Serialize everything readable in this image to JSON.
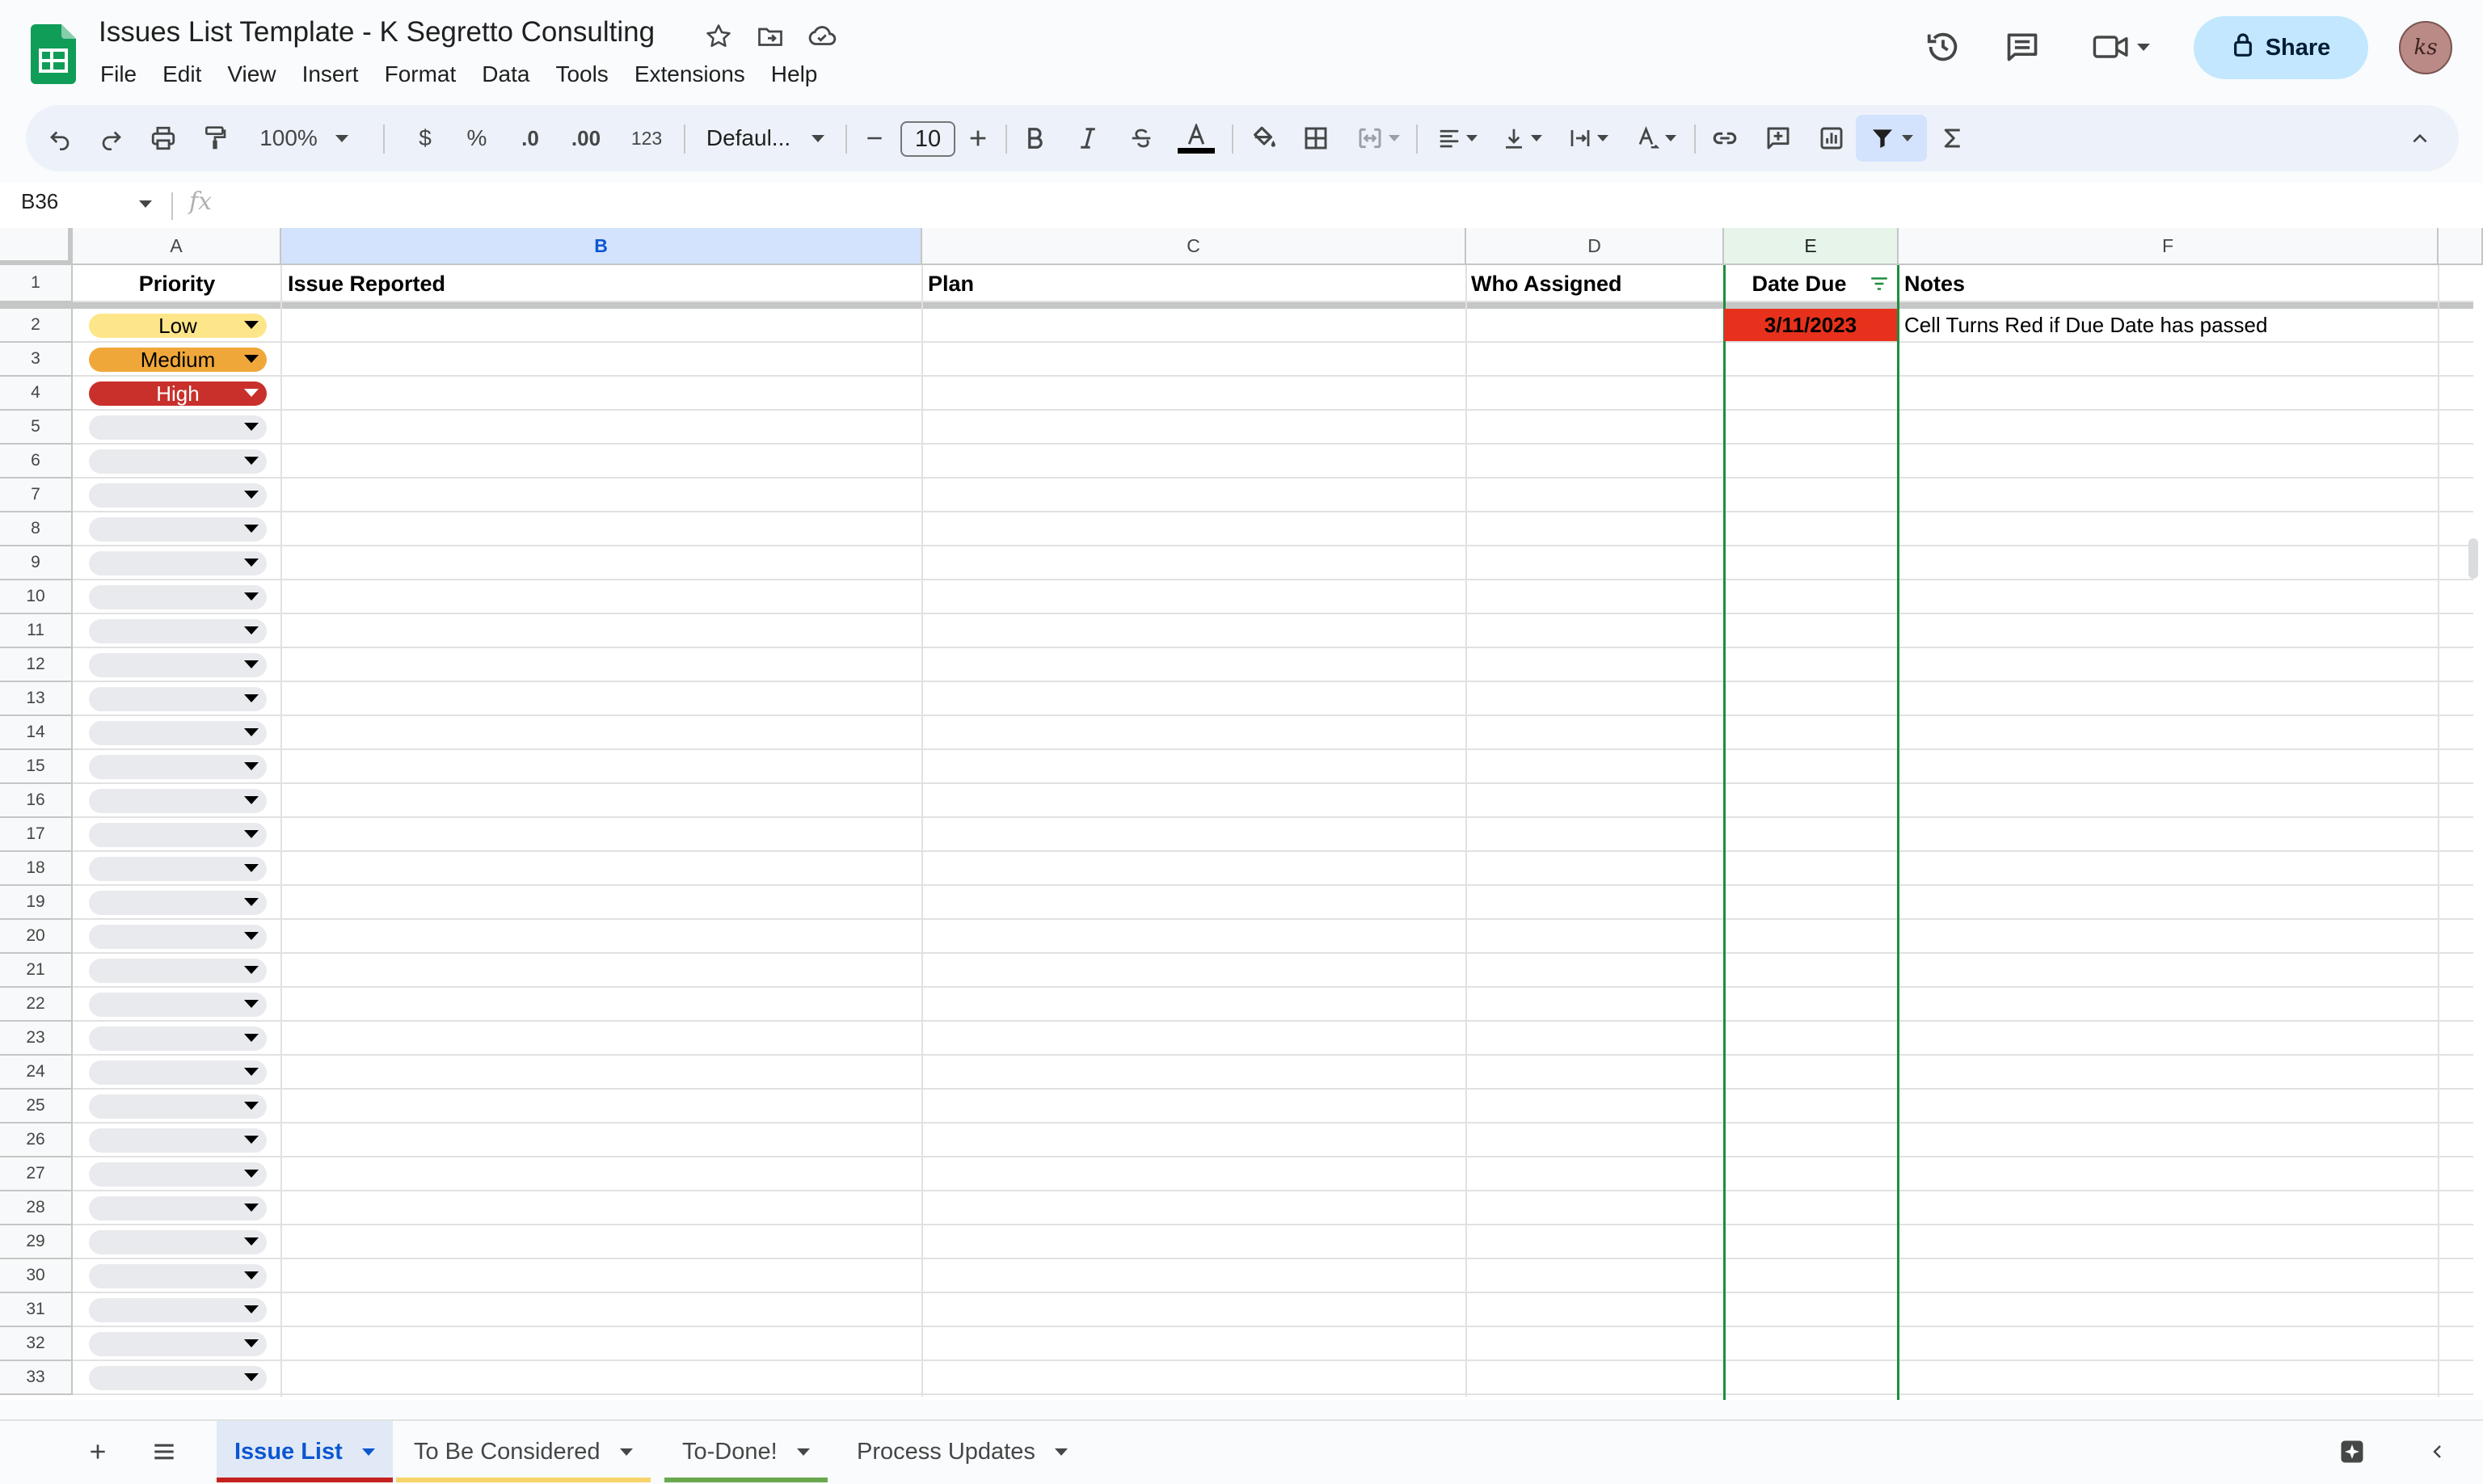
{
  "window": {
    "doc_title": "Issues List Template - K Segretto Consulting",
    "share_label": "Share",
    "avatar_initials": "ks"
  },
  "menu": [
    "File",
    "Edit",
    "View",
    "Insert",
    "Format",
    "Data",
    "Tools",
    "Extensions",
    "Help"
  ],
  "toolbar": {
    "zoom": "100%",
    "currency": "$",
    "percent": "%",
    "decrease_decimal": ".0",
    "increase_decimal": ".00",
    "number_format": "123",
    "font": "Defaul...",
    "font_size": "10"
  },
  "formula_bar": {
    "cell_ref": "B36",
    "fx_label": "fx"
  },
  "columns": [
    "A",
    "B",
    "C",
    "D",
    "E",
    "F"
  ],
  "header_row": {
    "priority": "Priority",
    "issue": "Issue Reported",
    "plan": "Plan",
    "who": "Who Assigned",
    "date_due": "Date Due",
    "notes": "Notes"
  },
  "row_numbers": [
    "1",
    "2",
    "3",
    "4",
    "5",
    "6",
    "7",
    "8",
    "9",
    "10",
    "11",
    "12",
    "13",
    "14",
    "15",
    "16",
    "17",
    "18",
    "19",
    "20",
    "21",
    "22",
    "23",
    "24",
    "25",
    "26",
    "27",
    "28",
    "29",
    "30",
    "31",
    "32",
    "33"
  ],
  "priority_values": [
    "Low",
    "Medium",
    "High"
  ],
  "row2": {
    "date_due": "3/11/2023",
    "note": "Cell Turns Red if Due Date has passed"
  },
  "tabs": [
    {
      "label": "Issue List",
      "active": true,
      "color": "#c5221f"
    },
    {
      "label": "To Be Considered",
      "active": false,
      "color": "#f6d46b"
    },
    {
      "label": "To-Done!",
      "active": false,
      "color": "#6aa84f"
    },
    {
      "label": "Process Updates",
      "active": false,
      "color": ""
    }
  ],
  "colors": {
    "sheets_green": "#0f9d58",
    "low": "#fde68a",
    "medium": "#f0a73a",
    "high": "#c9302c",
    "overdue": "#e8311c",
    "selection_blue": "#d3e3fd"
  }
}
